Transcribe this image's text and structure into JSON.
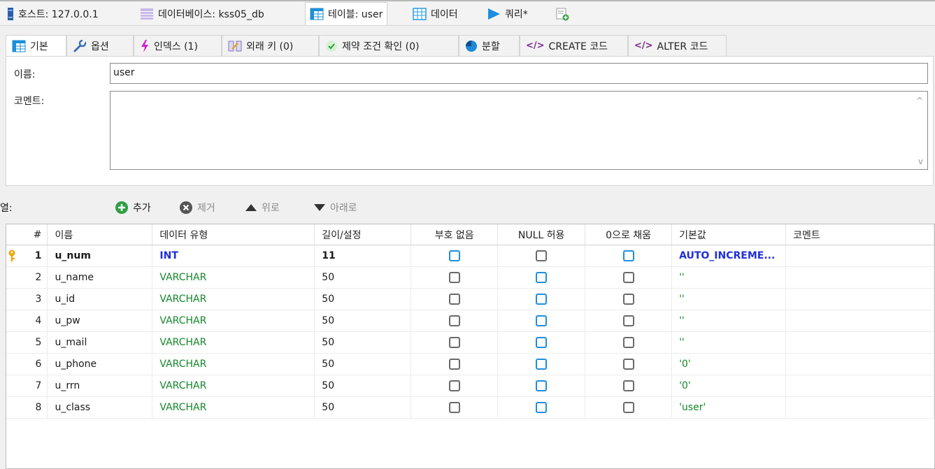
{
  "top_tabs": [
    {
      "label": "호스트: 127.0.0.1",
      "icon": "server-icon"
    },
    {
      "label": "데이터베이스: kss05_db",
      "icon": "database-icon"
    },
    {
      "label": "테이블: user",
      "icon": "table-icon"
    },
    {
      "label": "데이터",
      "icon": "data-grid-icon"
    },
    {
      "label": "쿼리*",
      "icon": "play-icon"
    },
    {
      "label": "",
      "icon": "new-query-tab-icon"
    }
  ],
  "sub_tabs": [
    {
      "label": "기본",
      "icon": "table-icon"
    },
    {
      "label": "옵션",
      "icon": "wrench-icon"
    },
    {
      "label": "인덱스 (1)",
      "icon": "lightning-icon"
    },
    {
      "label": "외래 키 (0)",
      "icon": "foreign-key-icon"
    },
    {
      "label": "제약 조건 확인 (0)",
      "icon": "check-icon"
    },
    {
      "label": "분할",
      "icon": "pie-icon"
    },
    {
      "label": "CREATE 코드",
      "icon": "code-icon"
    },
    {
      "label": "ALTER 코드",
      "icon": "code-icon"
    }
  ],
  "form": {
    "name_label": "이름:",
    "name_value": "user",
    "comment_label": "코멘트:",
    "comment_value": ""
  },
  "columns_toolbar": {
    "label": "열:",
    "add": "추가",
    "remove": "제거",
    "up": "위로",
    "down": "아래로"
  },
  "grid": {
    "headers": [
      "#",
      "이름",
      "데이터 유형",
      "길이/설정",
      "부호 없음",
      "NULL 허용",
      "0으로 채움",
      "기본값",
      "코멘트"
    ],
    "rows": [
      {
        "num": "1",
        "name": "u_num",
        "type": "INT",
        "length": "11",
        "unsigned": "blue",
        "nullable": "gray",
        "zerofill": "blue",
        "default": "AUTO_INCREME...",
        "comment": "",
        "primary": true
      },
      {
        "num": "2",
        "name": "u_name",
        "type": "VARCHAR",
        "length": "50",
        "unsigned": "gray",
        "nullable": "blue",
        "zerofill": "gray",
        "default": "''",
        "comment": "",
        "primary": false
      },
      {
        "num": "3",
        "name": "u_id",
        "type": "VARCHAR",
        "length": "50",
        "unsigned": "gray",
        "nullable": "blue",
        "zerofill": "gray",
        "default": "''",
        "comment": "",
        "primary": false
      },
      {
        "num": "4",
        "name": "u_pw",
        "type": "VARCHAR",
        "length": "50",
        "unsigned": "gray",
        "nullable": "blue",
        "zerofill": "gray",
        "default": "''",
        "comment": "",
        "primary": false
      },
      {
        "num": "5",
        "name": "u_mail",
        "type": "VARCHAR",
        "length": "50",
        "unsigned": "gray",
        "nullable": "blue",
        "zerofill": "gray",
        "default": "''",
        "comment": "",
        "primary": false
      },
      {
        "num": "6",
        "name": "u_phone",
        "type": "VARCHAR",
        "length": "50",
        "unsigned": "gray",
        "nullable": "blue",
        "zerofill": "gray",
        "default": "'0'",
        "comment": "",
        "primary": false
      },
      {
        "num": "7",
        "name": "u_rrn",
        "type": "VARCHAR",
        "length": "50",
        "unsigned": "gray",
        "nullable": "blue",
        "zerofill": "gray",
        "default": "'0'",
        "comment": "",
        "primary": false
      },
      {
        "num": "8",
        "name": "u_class",
        "type": "VARCHAR",
        "length": "50",
        "unsigned": "gray",
        "nullable": "blue",
        "zerofill": "gray",
        "default": "'user'",
        "comment": "",
        "primary": false
      }
    ]
  },
  "colors": {
    "primary_key_text": "#1f2fd8",
    "varchar_text": "#14872a",
    "checkbox_checked_like": "#1e8fe0",
    "checkbox_plain": "#6a6a6a",
    "key_icon": "#f0a500"
  }
}
